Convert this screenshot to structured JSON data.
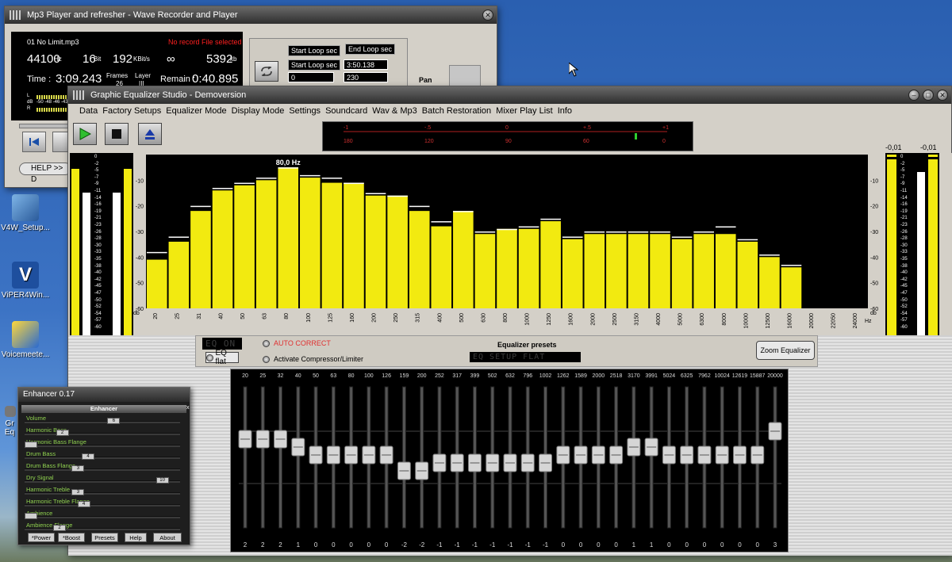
{
  "desktop": {
    "icons": [
      {
        "label": "V4W_Setup..."
      },
      {
        "label": "ViPER4Win..."
      },
      {
        "label": "Voicemeete..."
      },
      {
        "label": "Gr"
      },
      {
        "label": "Eq"
      }
    ]
  },
  "mp3_player": {
    "title": "Mp3 Player and refresher - Wave Recorder and Player",
    "file_name": "01 No Limit.mp3",
    "record_status": "No record File selected",
    "sample_rate": "44100",
    "sample_rate_unit": "Hz",
    "bits": "16",
    "bits_unit": "Bit",
    "bitrate": "192",
    "bitrate_unit": "KBit/s",
    "infinity": "∞",
    "size": "5392",
    "size_unit": "kb",
    "time_label": "Time :",
    "time_value": "3:09.243",
    "frames_label": "Frames",
    "frames_value": "26",
    "layer_label": "Layer",
    "layer_value": "III",
    "remain_label": "Remain :",
    "remain_value": "0:40.895",
    "meter_l": "L",
    "meter_db": "dB",
    "meter_r": "R",
    "meter_scale": "-50 -48 -46 -43",
    "start_loop_label": "Start Loop sec",
    "end_loop_label": "End Loop sec",
    "start_loop_label2": "Start Loop sec",
    "start_loop_value": "0",
    "end_loop_value1": "3:50.138",
    "end_loop_value2": "230",
    "pan_label": "Pan",
    "help_label": "HELP >> D"
  },
  "equalizer": {
    "title": "Graphic Equalizer Studio - Demoversion",
    "menu": [
      "Data",
      "Factory Setups",
      "Equalizer Mode",
      "Display Mode",
      "Settings",
      "Soundcard",
      "Wav & Mp3",
      "Batch Restoration",
      "Mixer Play List",
      "Info"
    ],
    "phase_scale_top": [
      "-1",
      "-.5",
      "0",
      "+.5",
      "+1"
    ],
    "phase_scale_bottom": [
      "180",
      "120",
      "90",
      "60",
      "0"
    ],
    "right_meter_left": "-0,01",
    "right_meter_right": "-0,01",
    "peak_label": "80,0 Hz",
    "db_unit": "db",
    "hz_unit": "Hz",
    "y_ticks": [
      "-10",
      "-20",
      "-30",
      "-40",
      "-50",
      "-60"
    ],
    "vu_scale": [
      "0",
      "-2",
      "-5",
      "-7",
      "-9",
      "-11",
      "-14",
      "-16",
      "-19",
      "-21",
      "-23",
      "-26",
      "-28",
      "-30",
      "-33",
      "-35",
      "-38",
      "-40",
      "-42",
      "-45",
      "-47",
      "-50",
      "-52",
      "-54",
      "-57",
      "-60"
    ],
    "eq_on": "EQ ON",
    "eq_flat": "EQ flat",
    "auto_correct": "AUTO CORRECT",
    "compressor": "Activate Compressor/Limiter",
    "presets_label": "Equalizer presets",
    "preset_value": "EQ SETUP FLAT",
    "zoom_button": "Zoom Equalizer"
  },
  "chart_data": {
    "type": "bar",
    "title": "",
    "xlabel": "Hz",
    "ylabel": "db",
    "ylim": [
      -60,
      0
    ],
    "categories": [
      "20",
      "25",
      "31",
      "40",
      "50",
      "63",
      "80",
      "100",
      "125",
      "160",
      "200",
      "250",
      "315",
      "400",
      "500",
      "630",
      "800",
      "1000",
      "1250",
      "1600",
      "2000",
      "2500",
      "3150",
      "4000",
      "5000",
      "6300",
      "8000",
      "10000",
      "12500",
      "16000",
      "20000",
      "22050",
      "24000"
    ],
    "values": [
      -41,
      -34,
      -22,
      -14,
      -12,
      -10,
      -5,
      -9,
      -11,
      -11,
      -16,
      -16,
      -22,
      -28,
      -22,
      -31,
      -29,
      -29,
      -26,
      -33,
      -31,
      -31,
      -31,
      -31,
      -33,
      -31,
      -31,
      -34,
      -40,
      -44,
      -60,
      -60,
      -60
    ],
    "peaks": [
      -38,
      -32,
      -20,
      -13,
      -11,
      -9,
      -5,
      -8,
      -9,
      -11,
      -15,
      -16,
      -20,
      -26,
      -22,
      -30,
      -29,
      -28,
      -25,
      -32,
      -30,
      -30,
      -30,
      -30,
      -32,
      -30,
      -28,
      -33,
      -39,
      -43,
      -60,
      -60,
      -60
    ],
    "grid": false,
    "legend": "none"
  },
  "sliders": {
    "freqs": [
      "20",
      "25",
      "32",
      "40",
      "50",
      "63",
      "80",
      "100",
      "126",
      "159",
      "200",
      "252",
      "317",
      "399",
      "502",
      "632",
      "796",
      "1002",
      "1262",
      "1589",
      "2000",
      "2518",
      "3170",
      "3991",
      "5024",
      "6325",
      "7962",
      "10024",
      "12619",
      "15887",
      "20000"
    ],
    "values": [
      2,
      2,
      2,
      1,
      0,
      0,
      0,
      0,
      0,
      -2,
      -2,
      -1,
      -1,
      -1,
      -1,
      -1,
      -1,
      -1,
      0,
      0,
      0,
      0,
      1,
      1,
      0,
      0,
      0,
      0,
      0,
      0,
      3
    ],
    "value_labels": [
      "2",
      "2",
      "2",
      "1",
      "0",
      "0",
      "0",
      "0",
      "0",
      "-2",
      "-2",
      "-1",
      "-1",
      "-1",
      "-1",
      "-1",
      "-1",
      "-1",
      "0",
      "0",
      "0",
      "0",
      "1",
      "1",
      "0",
      "0",
      "0",
      "0",
      "0",
      "0",
      "3"
    ]
  },
  "enhancer": {
    "title": "Enhancer 0.17",
    "header": "Enhancer",
    "rows": [
      {
        "label": "Volume",
        "knob": "6",
        "level": 0.58
      },
      {
        "label": "Harmonic Bass",
        "knob": "2",
        "level": 0.22
      },
      {
        "label": "Harmonic Bass Flange",
        "knob": "",
        "level": 0.0
      },
      {
        "label": "Drum Bass",
        "knob": "4",
        "level": 0.4
      },
      {
        "label": "Drum Bass Flange",
        "knob": "3",
        "level": 0.33
      },
      {
        "label": "Dry Signal",
        "knob": "10",
        "level": 0.92
      },
      {
        "label": "Harmonic Treble",
        "knob": "3",
        "level": 0.33
      },
      {
        "label": "Harmonic Treble Flange",
        "knob": "4",
        "level": 0.37
      },
      {
        "label": "Ambience",
        "knob": "",
        "level": 0.0
      },
      {
        "label": "Ambience Flange",
        "knob": "2",
        "level": 0.2
      }
    ],
    "buttons": [
      "*Power",
      "*Boost",
      "Presets",
      "Help",
      "About"
    ]
  }
}
